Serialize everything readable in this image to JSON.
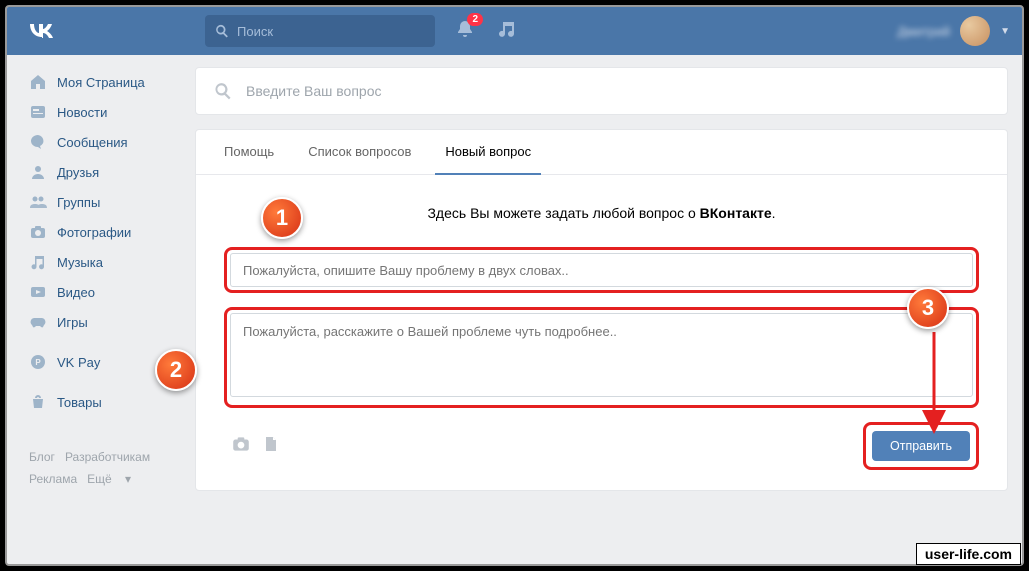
{
  "header": {
    "search_placeholder": "Поиск",
    "notif_count": "2",
    "user_name": "Дмитрий"
  },
  "sidebar": {
    "items": [
      {
        "label": "Моя Страница"
      },
      {
        "label": "Новости"
      },
      {
        "label": "Сообщения"
      },
      {
        "label": "Друзья"
      },
      {
        "label": "Группы"
      },
      {
        "label": "Фотографии"
      },
      {
        "label": "Музыка"
      },
      {
        "label": "Видео"
      },
      {
        "label": "Игры"
      }
    ],
    "vkpay": "VK Pay",
    "market": "Товары"
  },
  "footer": {
    "blog": "Блог",
    "dev": "Разработчикам",
    "ads": "Реклама",
    "more": "Ещё"
  },
  "main": {
    "search_placeholder": "Введите Ваш вопрос",
    "tabs": [
      {
        "label": "Помощь"
      },
      {
        "label": "Список вопросов"
      },
      {
        "label": "Новый вопрос"
      }
    ],
    "title_pre": "Здесь Вы можете задать любой вопрос о ",
    "title_bold": "ВКонтакте",
    "title_post": ".",
    "input_placeholder": "Пожалуйста, опишите Вашу проблему в двух словах..",
    "textarea_placeholder": "Пожалуйста, расскажите о Вашей проблеме чуть подробнее..",
    "submit": "Отправить"
  },
  "markers": {
    "m1": "1",
    "m2": "2",
    "m3": "3"
  },
  "watermark": "user-life.com"
}
